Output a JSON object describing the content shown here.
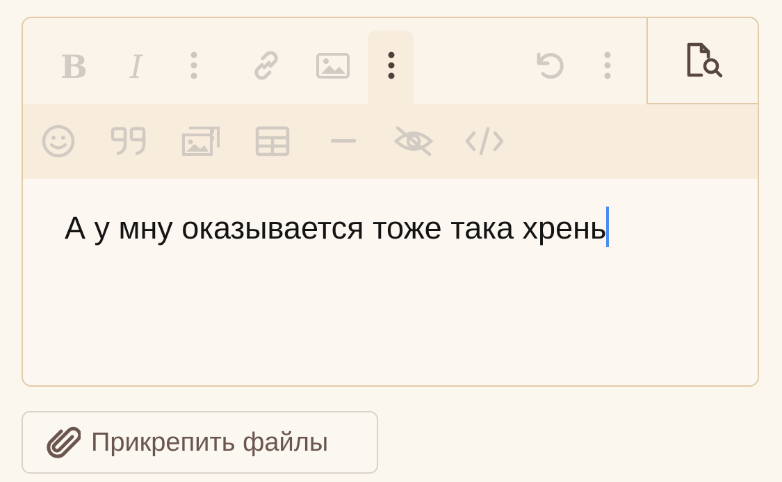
{
  "toolbar": {
    "row1": [
      {
        "name": "bold-button",
        "icon": "bold-icon"
      },
      {
        "name": "italic-button",
        "icon": "italic-icon"
      },
      {
        "name": "more-text-options-button",
        "icon": "vertical-dots-icon"
      },
      {
        "name": "insert-link-button",
        "icon": "link-icon"
      },
      {
        "name": "insert-image-button",
        "icon": "image-icon"
      },
      {
        "name": "more-insert-options-button",
        "icon": "vertical-dots-icon",
        "active": true
      },
      {
        "name": "undo-button",
        "icon": "undo-icon"
      },
      {
        "name": "more-options-button",
        "icon": "vertical-dots-icon"
      }
    ],
    "preview": {
      "name": "preview-button",
      "icon": "document-search-icon"
    },
    "row2": [
      {
        "name": "insert-emoji-button",
        "icon": "smiley-icon"
      },
      {
        "name": "insert-quote-button",
        "icon": "quote-icon"
      },
      {
        "name": "insert-gallery-button",
        "icon": "gallery-icon"
      },
      {
        "name": "insert-table-button",
        "icon": "table-icon"
      },
      {
        "name": "insert-horizontal-line-button",
        "icon": "minus-icon"
      },
      {
        "name": "insert-spoiler-button",
        "icon": "eye-slash-icon"
      },
      {
        "name": "insert-code-button",
        "icon": "code-icon"
      }
    ]
  },
  "editor": {
    "text": "А у мну оказывается тоже така хрень"
  },
  "attach": {
    "label": "Прикрепить файлы",
    "icon": "paperclip-icon"
  },
  "colors": {
    "background": "#fbf6ee",
    "border": "#e2cba6",
    "toolbar_row2": "#f8ecdc",
    "icon_inactive": "#cfc7bf",
    "icon_active": "#5b4a42",
    "caret": "#4a8cf0"
  }
}
